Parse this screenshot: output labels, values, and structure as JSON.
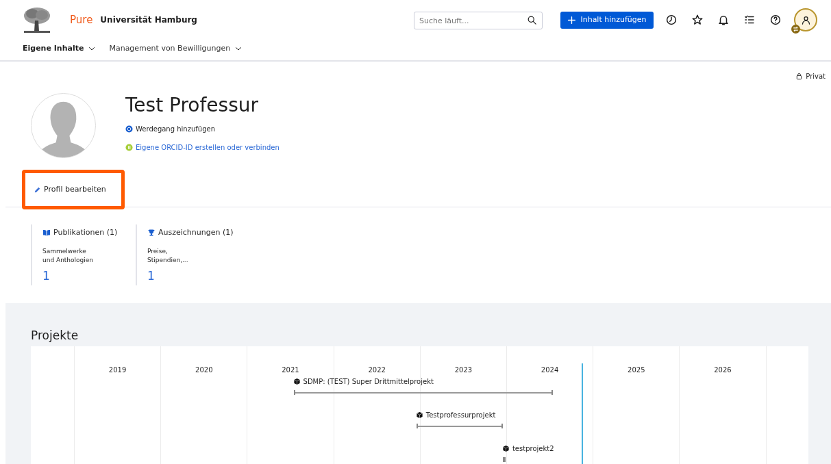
{
  "header": {
    "brand": "Pure",
    "institution": "Universität Hamburg",
    "search": {
      "placeholder": "Suche läuft..."
    },
    "add_button": "Inhalt hinzufügen"
  },
  "nav": [
    {
      "label": "Eigene Inhalte",
      "selected": true
    },
    {
      "label": "Management von Bewilligungen",
      "selected": false
    }
  ],
  "visibility": "Privat",
  "profile": {
    "name": "Test Professur",
    "links": [
      {
        "kind": "cv",
        "label": "Werdegang hinzufügen"
      },
      {
        "kind": "orcid",
        "label": "Eigene ORCID-ID erstellen oder verbinden"
      }
    ],
    "edit": {
      "label": "Profil bearbeiten",
      "highlighted": true
    }
  },
  "stats": [
    {
      "kind": "publications",
      "title": "Publikationen (1)",
      "subtitle": "Sammelwerke\nund Anthologien",
      "count": "1"
    },
    {
      "kind": "awards",
      "title": "Auszeichnungen (1)",
      "subtitle": "Preise,\nStipendien,...",
      "count": "1"
    }
  ],
  "projects": {
    "title": "Projekte",
    "years": [
      "2019",
      "2020",
      "2021",
      "2022",
      "2023",
      "2024",
      "2025",
      "2026"
    ],
    "items": [
      {
        "label": "SDMP: (TEST) Super Drittmittelprojekt"
      },
      {
        "label": "Testprofessurprojekt"
      },
      {
        "label": "testprojekt2"
      }
    ]
  }
}
